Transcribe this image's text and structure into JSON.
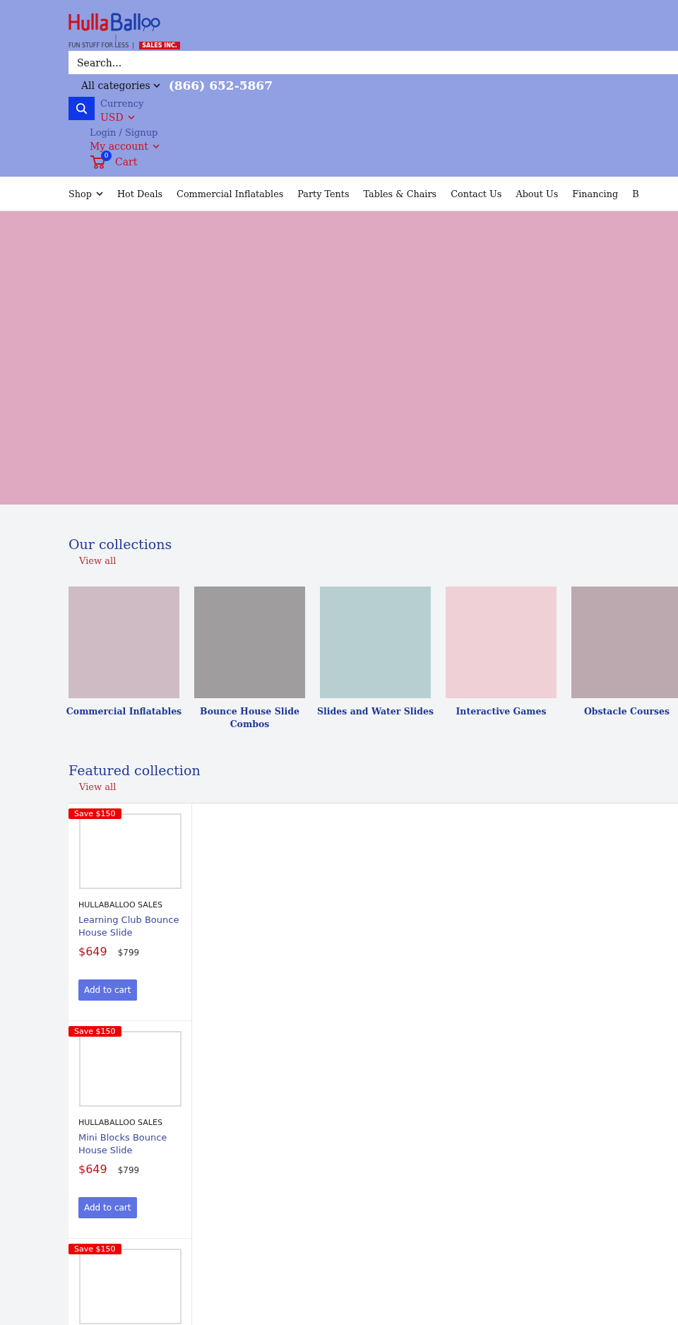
{
  "header": {
    "logo": {
      "tagline": "FUN STUFF FOR LESS",
      "badge": "SALES INC."
    },
    "search": {
      "placeholder": "Search..."
    },
    "category_select": {
      "value": "All categories"
    },
    "phone": "(866) 652-5867",
    "currency": {
      "label": "Currency",
      "value": "USD"
    },
    "account": {
      "login": "Login / Signup",
      "label": "My account"
    },
    "cart": {
      "count": "0",
      "label": "Cart"
    }
  },
  "nav": [
    {
      "label": "Shop",
      "dropdown": true
    },
    {
      "label": "Hot Deals",
      "dropdown": false
    },
    {
      "label": "Commercial Inflatables",
      "dropdown": false
    },
    {
      "label": "Party Tents",
      "dropdown": false
    },
    {
      "label": "Tables & Chairs",
      "dropdown": false
    },
    {
      "label": "Contact Us",
      "dropdown": false
    },
    {
      "label": "About Us",
      "dropdown": false
    },
    {
      "label": "Financing",
      "dropdown": false
    },
    {
      "label": "B",
      "dropdown": false
    }
  ],
  "collections": {
    "title": "Our collections",
    "view_all": "View all",
    "items": [
      {
        "name": "Commercial Inflatables",
        "color": "#cebbc3"
      },
      {
        "name": "Bounce House Slide Combos",
        "color": "#9f9d9e"
      },
      {
        "name": "Slides and Water Slides",
        "color": "#b8cfd2"
      },
      {
        "name": "Interactive Games",
        "color": "#efd0d6"
      },
      {
        "name": "Obstacle Courses",
        "color": "#bca9b0"
      }
    ]
  },
  "featured": {
    "title": "Featured collection",
    "view_all": "View all",
    "products": [
      {
        "badge": "Save $150",
        "vendor": "HULLABALLOO SALES",
        "title": "Learning Club Bounce House Slide",
        "price": "$649",
        "compare_price": "$799",
        "button": "Add to cart"
      },
      {
        "badge": "Save $150",
        "vendor": "HULLABALLOO SALES",
        "title": "Mini Blocks Bounce House Slide",
        "price": "$649",
        "compare_price": "$799",
        "button": "Add to cart"
      },
      {
        "badge": "Save $150"
      }
    ]
  }
}
